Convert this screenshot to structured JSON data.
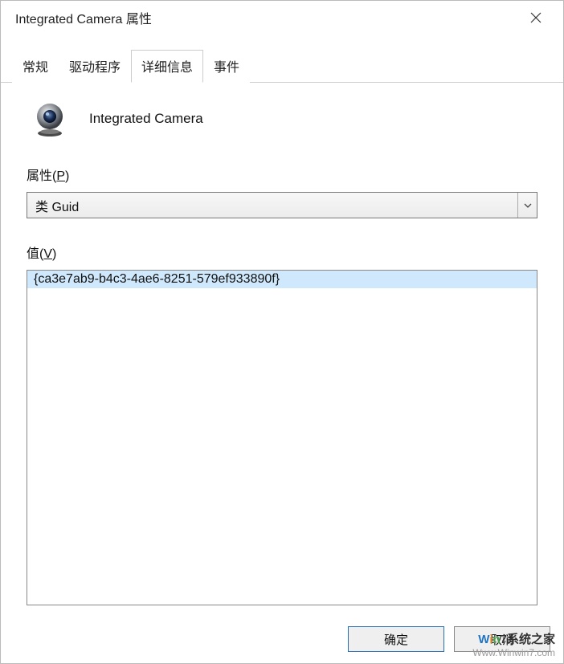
{
  "window": {
    "title": "Integrated Camera 属性"
  },
  "tabs": {
    "general": "常规",
    "driver": "驱动程序",
    "details": "详细信息",
    "events": "事件"
  },
  "device": {
    "name": "Integrated Camera"
  },
  "labels": {
    "property_prefix": "属性(",
    "property_hotkey": "P",
    "property_suffix": ")",
    "value_prefix": "值(",
    "value_hotkey": "V",
    "value_suffix": ")"
  },
  "dropdown": {
    "selected": "类 Guid"
  },
  "values": [
    "{ca3e7ab9-b4c3-4ae6-8251-579ef933890f}"
  ],
  "buttons": {
    "ok": "确定",
    "cancel": "取消"
  },
  "watermark": {
    "brand": "Win7系统之家",
    "url": "Www.Winwin7.com"
  }
}
